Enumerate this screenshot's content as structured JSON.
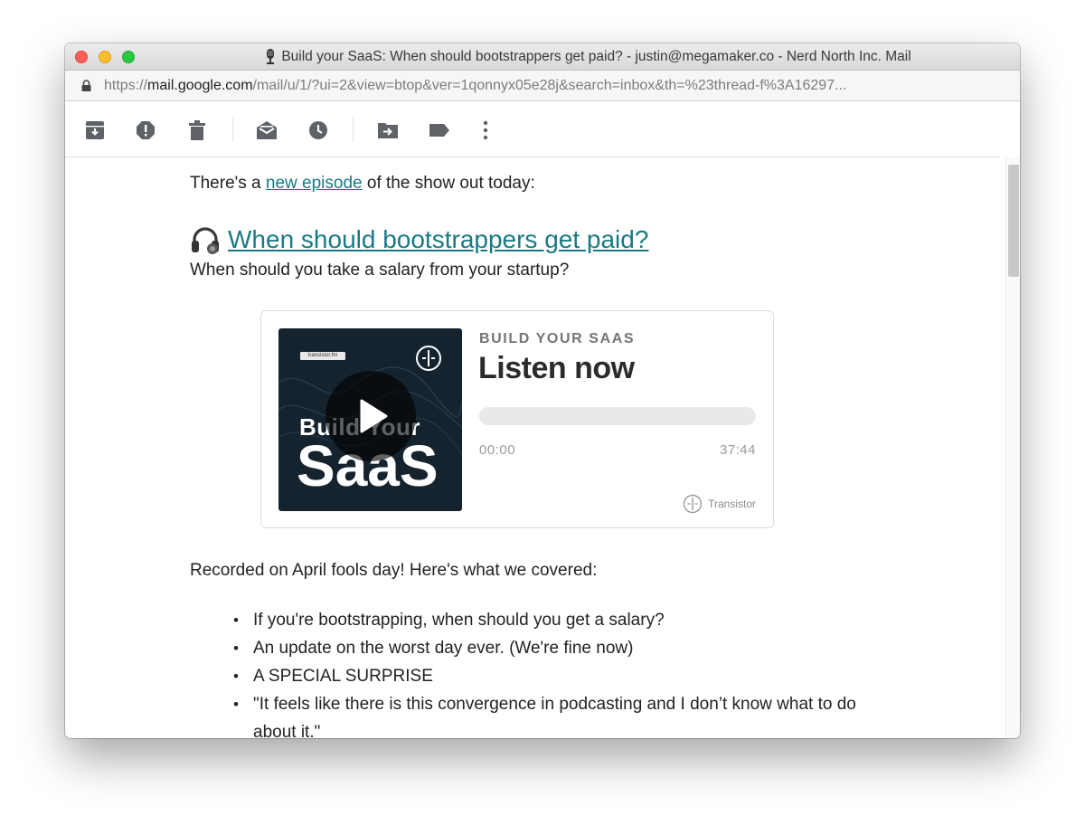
{
  "window": {
    "title": "Build your SaaS: When should bootstrappers get paid? - justin@megamaker.co - Nerd North Inc. Mail",
    "url_scheme": "https://",
    "url_host": "mail.google.com",
    "url_path": "/mail/u/1/?ui=2&view=btop&ver=1qonnyx05e28j&search=inbox&th=%23thread-f%3A16297..."
  },
  "toolbar": {
    "buttons": [
      {
        "icon": "archive-icon"
      },
      {
        "icon": "report-spam-icon"
      },
      {
        "icon": "delete-icon"
      },
      {
        "icon": "mark-unread-icon"
      },
      {
        "icon": "snooze-icon"
      },
      {
        "icon": "move-to-icon"
      },
      {
        "icon": "label-icon"
      },
      {
        "icon": "more-icon"
      }
    ]
  },
  "email": {
    "intro_before": "There's a ",
    "intro_link": "new episode",
    "intro_after": " of the show out today:",
    "episode_title": "When should bootstrappers get paid?",
    "episode_subtitle": "When should you take a salary from your startup?",
    "recorded_text": "Recorded on April fools day! Here's what we covered:",
    "bullets": [
      "If you're bootstrapping, when should you get a salary?",
      "An update on the worst day ever. (We're fine now)",
      "A SPECIAL SURPRISE",
      "\"It feels like there is this convergence in podcasting and I don’t know what to do about it.\""
    ]
  },
  "player": {
    "cover_badge": "transistor.fm",
    "cover_line1": "Build Your",
    "cover_line2": "SaaS",
    "show_name": "BUILD YOUR SAAS",
    "cta": "Listen now",
    "progress_fraction": 0,
    "time_current": "00:00",
    "time_total": "37:44",
    "brand": "Transistor"
  },
  "colors": {
    "link": "#1a7a84",
    "cover_bg": "#15232e",
    "close": "#fc5f57",
    "minimize": "#fdbc2e",
    "maximize": "#28c840"
  }
}
